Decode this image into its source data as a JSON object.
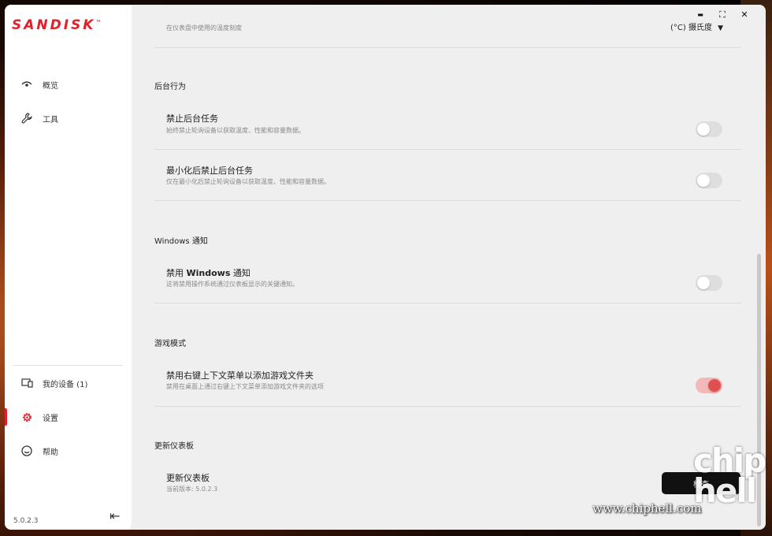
{
  "brand": {
    "logo_text": "SANDISK",
    "tm": "™"
  },
  "sidebar": {
    "top_items": [
      {
        "label": "概览",
        "icon": "eye-icon"
      },
      {
        "label": "工具",
        "icon": "wrench-icon"
      }
    ],
    "bottom_items": [
      {
        "label": "我的设备 (1)",
        "icon": "devices-icon"
      },
      {
        "label": "设置",
        "icon": "gear-icon",
        "active": true
      },
      {
        "label": "帮助",
        "icon": "smiley-help-icon"
      }
    ],
    "version": "5.0.2.3",
    "collapse_glyph": "⇤"
  },
  "window_controls": {
    "minimize": "▬",
    "maximize": "⛶",
    "close": "✕"
  },
  "settings": {
    "temperature": {
      "subtitle": "在仪表盘中使用的温度刻度",
      "unit_value": "(°C) 摄氏度"
    },
    "background": {
      "section_title": "后台行为",
      "rows": [
        {
          "title": "禁止后台任务",
          "subtitle": "始终禁止轮询设备以获取温度、性能和容量数据。",
          "enabled": false
        },
        {
          "title": "最小化后禁止后台任务",
          "subtitle": "仅在最小化后禁止轮询设备以获取温度、性能和容量数据。",
          "enabled": false
        }
      ]
    },
    "notifications": {
      "section_title": "Windows 通知",
      "row": {
        "title_prefix": "禁用 ",
        "title_bold": "Windows",
        "title_suffix": " 通知",
        "subtitle": "这将禁用操作系统通过仪表板显示的关键通知。",
        "enabled": false
      }
    },
    "game_mode": {
      "section_title": "游戏模式",
      "row": {
        "title": "禁用右键上下文菜单以添加游戏文件夹",
        "subtitle": "禁用在桌面上通过右键上下文菜单添加游戏文件夹的选项",
        "enabled": true
      }
    },
    "update": {
      "section_title": "更新仪表板",
      "title": "更新仪表板",
      "subtitle": "当前版本: 5.0.2.3",
      "button_label": "检查"
    }
  },
  "watermark": {
    "url": "www.chiphell.com",
    "logo_line1": "chip",
    "logo_line2": "hell"
  },
  "colors": {
    "accent": "#e1212a",
    "toggle_on_track": "#f3b8b8",
    "toggle_on_knob": "#e05050"
  }
}
